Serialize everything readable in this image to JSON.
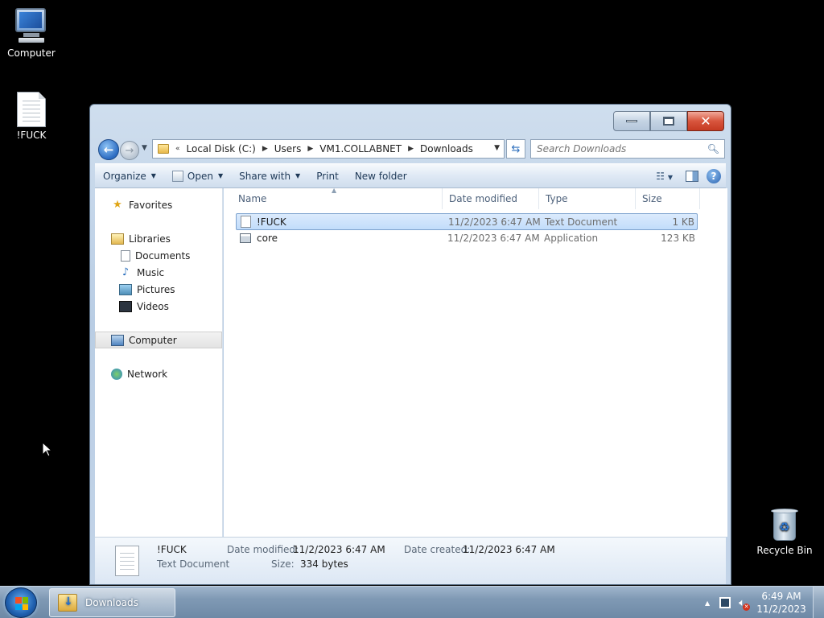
{
  "desktop": {
    "icons": [
      {
        "label": "Computer",
        "icon": "computer-icon"
      },
      {
        "label": "!FUCK",
        "icon": "text-document-icon"
      },
      {
        "label": "Recycle Bin",
        "icon": "recycle-bin-icon"
      }
    ]
  },
  "window": {
    "caption_buttons": [
      "minimize",
      "maximize",
      "close"
    ],
    "address": {
      "overflow": "«",
      "crumbs": [
        "Local Disk (C:)",
        "Users",
        "VM1.COLLABNET",
        "Downloads"
      ]
    },
    "search_placeholder": "Search Downloads",
    "toolbar": {
      "organize": "Organize",
      "open": "Open",
      "share_with": "Share with",
      "print": "Print",
      "new_folder": "New folder"
    },
    "nav": {
      "favorites": "Favorites",
      "libraries": "Libraries",
      "documents": "Documents",
      "music": "Music",
      "pictures": "Pictures",
      "videos": "Videos",
      "computer": "Computer",
      "network": "Network",
      "selected": "Computer"
    },
    "columns": {
      "name": "Name",
      "date_modified": "Date modified",
      "type": "Type",
      "size": "Size"
    },
    "files": [
      {
        "name": "!FUCK",
        "date": "11/2/2023 6:47 AM",
        "type": "Text Document",
        "size": "1 KB",
        "selected": true
      },
      {
        "name": "core",
        "date": "11/2/2023 6:47 AM",
        "type": "Application",
        "size": "123 KB",
        "selected": false
      }
    ],
    "details": {
      "name": "!FUCK",
      "type": "Text Document",
      "date_modified_label": "Date modified:",
      "date_modified": "11/2/2023 6:47 AM",
      "size_label": "Size:",
      "size": "334 bytes",
      "date_created_label": "Date created:",
      "date_created": "11/2/2023 6:47 AM"
    }
  },
  "taskbar": {
    "task_label": "Downloads",
    "time": "6:49 AM",
    "date": "11/2/2023"
  },
  "colors": {
    "desktop_bg": "#000000",
    "selection": "#c1dcfb",
    "close_button": "#c53a22",
    "taskbar": "#7f99b4"
  }
}
